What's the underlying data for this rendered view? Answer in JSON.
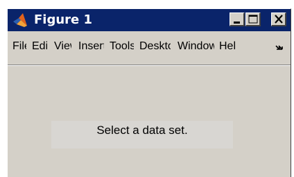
{
  "window": {
    "title": "Figure 1",
    "icon": "matlab-logo-icon"
  },
  "title_buttons": {
    "minimize_icon": "minimize-icon",
    "maximize_icon": "maximize-icon",
    "close_icon": "close-icon"
  },
  "menu": {
    "items": [
      {
        "label": "File"
      },
      {
        "label": "Edit"
      },
      {
        "label": "View"
      },
      {
        "label": "Insert"
      },
      {
        "label": "Tools"
      },
      {
        "label": "Desktop"
      },
      {
        "label": "Window"
      },
      {
        "label": "Help"
      }
    ],
    "overflow_icon": "chevron-icon"
  },
  "main": {
    "status_text": "Select a data set."
  },
  "colors": {
    "titlebar": "#0a246a",
    "face": "#d4d0c8",
    "panel": "#d8d6d2"
  }
}
